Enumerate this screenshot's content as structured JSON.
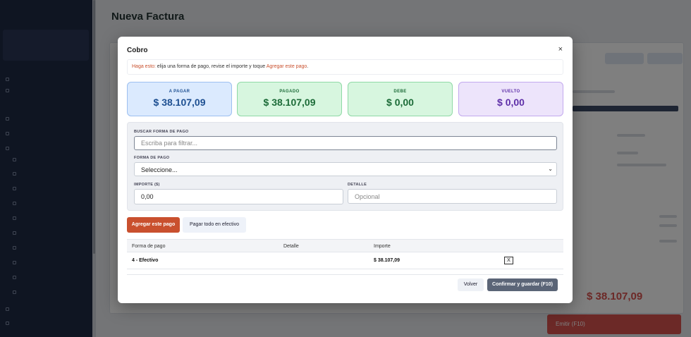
{
  "background": {
    "page_title": "Nueva Factura",
    "total_value": "$ 38.107,09",
    "emit_button": "Emitir (F10)"
  },
  "modal": {
    "title": "Cobro",
    "close_glyph": "×",
    "hint": {
      "prefix": "Haga esto:",
      "text": " elija una forma de pago, revise el importe y toque ",
      "action": "Agregar este pago",
      "suffix": "."
    },
    "summary": {
      "a_pagar": {
        "label": "A PAGAR",
        "value": "$ 38.107,09"
      },
      "pagado": {
        "label": "PAGADO",
        "value": "$ 38.107,09"
      },
      "debe": {
        "label": "DEBE",
        "value": "$ 0,00"
      },
      "vuelto": {
        "label": "VUELTO",
        "value": "$ 0,00"
      }
    },
    "form": {
      "search_label": "BUSCAR FORMA DE PAGO",
      "search_placeholder": "Escriba para filtrar...",
      "method_label": "FORMA DE PAGO",
      "method_selected": "Seleccione...",
      "amount_label": "IMPORTE ($)",
      "amount_value": "0,00",
      "detail_label": "DETALLE",
      "detail_placeholder": "Opcional"
    },
    "buttons": {
      "add": "Agregar este pago",
      "cash": "Pagar todo en efectivo",
      "back": "Volver",
      "confirm": "Confirmar y guardar (F10)"
    },
    "table": {
      "columns": [
        "Forma de pago",
        "Detalle",
        "Importe"
      ],
      "rows": [
        {
          "method": "4 - Efectivo",
          "detail": "",
          "amount": "$ 38.107,09",
          "delete": "X"
        }
      ]
    }
  },
  "icons": [
    "close-icon",
    "chevron-down-icon"
  ],
  "colors": {
    "accent": "#c9502e",
    "pagar": "#1d4f91",
    "pagado": "#1c6b38",
    "vuelto": "#5e2fa8",
    "confirm": "#5b6577"
  }
}
